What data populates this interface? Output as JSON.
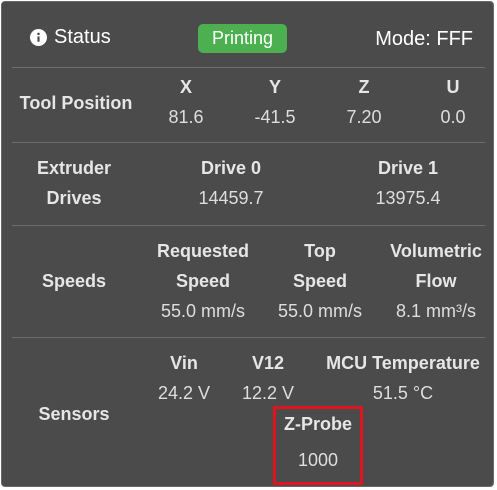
{
  "header": {
    "status_label": "Status",
    "status_badge": "Printing",
    "mode": "Mode: FFF",
    "colors": {
      "badge_bg": "#4caf50",
      "panel_bg": "#4b4b4b",
      "highlight": "#e0141e"
    },
    "icons": {
      "status": "info-icon"
    }
  },
  "tool_position": {
    "label": "Tool Position",
    "axes": [
      {
        "name": "X",
        "value": "81.6"
      },
      {
        "name": "Y",
        "value": "-41.5"
      },
      {
        "name": "Z",
        "value": "7.20"
      },
      {
        "name": "U",
        "value": "0.0"
      }
    ]
  },
  "extruder": {
    "label_line1": "Extruder",
    "label_line2": "Drives",
    "drives": [
      {
        "name": "Drive 0",
        "value": "14459.7"
      },
      {
        "name": "Drive 1",
        "value": "13975.4"
      }
    ]
  },
  "speeds": {
    "label": "Speeds",
    "items": [
      {
        "line1": "Requested",
        "line2": "Speed",
        "value": "55.0 mm/s"
      },
      {
        "line1": "Top",
        "line2": "Speed",
        "value": "55.0 mm/s"
      },
      {
        "line1": "Volumetric",
        "line2": "Flow",
        "value": "8.1 mm³/s"
      }
    ]
  },
  "sensors": {
    "label": "Sensors",
    "vin": {
      "name": "Vin",
      "value": "24.2 V"
    },
    "v12": {
      "name": "V12",
      "value": "12.2 V"
    },
    "mcu": {
      "name": "MCU Temperature",
      "value": "51.5 °C"
    },
    "zprobe": {
      "name": "Z-Probe",
      "value": "1000"
    }
  }
}
